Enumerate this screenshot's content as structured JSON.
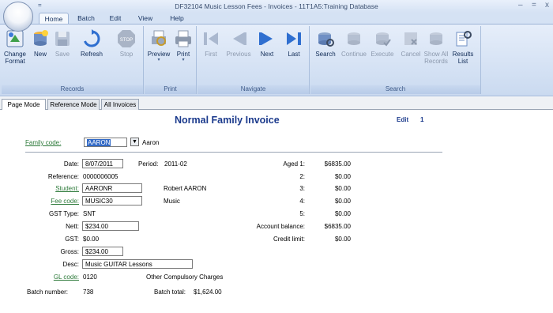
{
  "window": {
    "title": "DF32104 Music Lesson Fees - Invoices - 11T1A5:Training Database",
    "minimize": "–",
    "maximize": "=",
    "close": "x",
    "qat_label": "="
  },
  "ribbon_tabs": [
    "Home",
    "Batch",
    "Edit",
    "View",
    "Help"
  ],
  "ribbon": {
    "records": {
      "label": "Records",
      "change_format": "Change\nFormat",
      "new": "New",
      "save": "Save",
      "refresh": "Refresh",
      "stop": "Stop"
    },
    "print": {
      "label": "Print",
      "preview": "Preview",
      "print": "Print"
    },
    "navigate": {
      "label": "Navigate",
      "first": "First",
      "previous": "Previous",
      "next": "Next",
      "last": "Last"
    },
    "search": {
      "label": "Search",
      "search": "Search",
      "continue": "Continue",
      "execute": "Execute",
      "cancel": "Cancel",
      "show_all_records": "Show All\nRecords",
      "results_list": "Results\nList"
    }
  },
  "doc_tabs": [
    "Page Mode",
    "Reference Mode",
    "All Invoices"
  ],
  "form": {
    "title": "Normal Family Invoice",
    "edit_label": "Edit",
    "edit_count": "1",
    "family_code_label": "Family code:",
    "family_code_value": "AARON",
    "family_name": "Aaron",
    "date_label": "Date:",
    "date_value": "8/07/2011",
    "period_label": "Period:",
    "period_value": "2011-02",
    "reference_label": "Reference:",
    "reference_value": "0000006005",
    "student_label": "Student:",
    "student_value": "AARONR",
    "student_name": "Robert AARON",
    "fee_code_label": "Fee code:",
    "fee_code_value": "MUSIC30",
    "fee_code_desc": "Music",
    "gst_type_label": "GST Type:",
    "gst_type_value": "SNT",
    "nett_label": "Nett:",
    "nett_value": "$234.00",
    "gst_label": "GST:",
    "gst_value": "$0.00",
    "gross_label": "Gross:",
    "gross_value": "$234.00",
    "desc_label": "Desc:",
    "desc_value": "Music GUITAR Lessons",
    "gl_code_label": "GL code:",
    "gl_code_value": "0120",
    "gl_code_desc": "Other Compulsory Charges",
    "aged1_label": "Aged 1:",
    "aged1_value": "$6835.00",
    "aged2_label": "2:",
    "aged2_value": "$0.00",
    "aged3_label": "3:",
    "aged3_value": "$0.00",
    "aged4_label": "4:",
    "aged4_value": "$0.00",
    "aged5_label": "5:",
    "aged5_value": "$0.00",
    "account_balance_label": "Account balance:",
    "account_balance_value": "$6835.00",
    "credit_limit_label": "Credit limit:",
    "credit_limit_value": "$0.00",
    "batch_number_label": "Batch number:",
    "batch_number_value": "738",
    "batch_total_label": "Batch total:",
    "batch_total_value": "$1,624.00"
  }
}
